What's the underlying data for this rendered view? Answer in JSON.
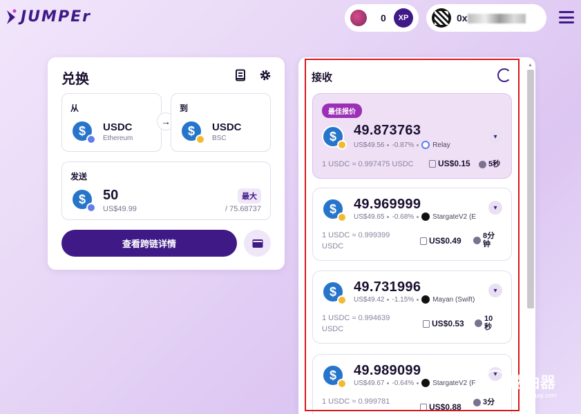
{
  "header": {
    "logo_text": "JUMPEr",
    "xp_count": "0",
    "xp_label": "XP",
    "wallet_prefix": "0x"
  },
  "exchange": {
    "title": "兑换",
    "from": {
      "label": "从",
      "token": "USDC",
      "chain": "Ethereum"
    },
    "to": {
      "label": "到",
      "token": "USDC",
      "chain": "BSC"
    },
    "send": {
      "label": "发送",
      "amount": "50",
      "usd": "US$49.99",
      "max_label": "最大",
      "balance": "/ 75.68737"
    },
    "primary_button": "查看跨链详情"
  },
  "receive": {
    "title": "接收",
    "routes": [
      {
        "tag": "最佳报价",
        "amount": "49.873763",
        "usd": "US$49.56",
        "change": "-0.87%",
        "bridge": "Relay",
        "rate": "1 USDC ≈ 0.997475 USDC",
        "gas": "US$0.15",
        "time": "5秒"
      },
      {
        "amount": "49.969999",
        "usd": "US$49.65",
        "change": "-0.68%",
        "bridge": "StargateV2 (E",
        "rate": "1 USDC ≈ 0.999399 USDC",
        "gas": "US$0.49",
        "time": "8分钟"
      },
      {
        "amount": "49.731996",
        "usd": "US$49.42",
        "change": "-1.15%",
        "bridge": "Mayan (Swift)",
        "rate": "1 USDC ≈ 0.994639 USDC",
        "gas": "US$0.53",
        "time": "10秒"
      },
      {
        "amount": "49.989099",
        "usd": "US$49.67",
        "change": "-0.64%",
        "bridge": "StargateV2 (F",
        "rate": "1 USDC ≈ 0.999781",
        "gas": "US$0.88",
        "time": "3分"
      }
    ]
  },
  "watermark": {
    "text": "路由器",
    "url": "luyouqi.com"
  },
  "colors": {
    "brand": "#3f1a86",
    "best_tag": "#9b2fb5",
    "highlight": "#d9141c",
    "usdc": "#2775ca"
  }
}
